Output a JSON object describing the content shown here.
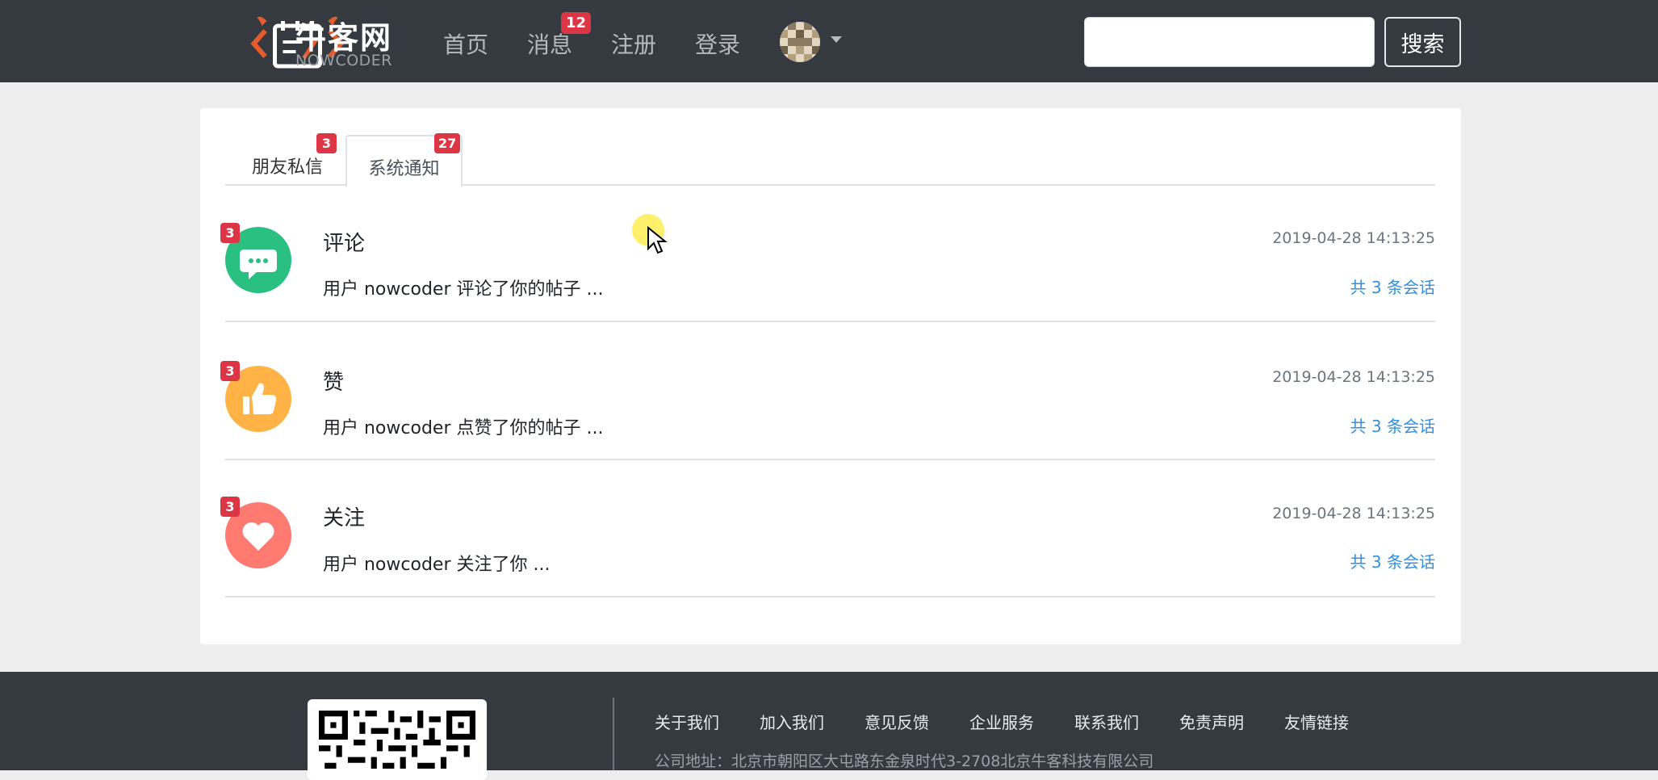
{
  "header": {
    "logo_text": "牛客网",
    "logo_sub": "NOWCODER",
    "nav": {
      "home": "首页",
      "messages": "消息",
      "messages_badge": "12",
      "register": "注册",
      "login": "登录"
    },
    "search": {
      "value": "",
      "placeholder": "",
      "button": "搜索"
    }
  },
  "tabs": [
    {
      "label": "朋友私信",
      "badge": "3"
    },
    {
      "label": "系统通知",
      "badge": "27"
    }
  ],
  "notices": [
    {
      "title": "评论",
      "text": "用户 nowcoder 评论了你的帖子 ...",
      "time": "2019-04-28 14:13:25",
      "link": "共 3 条会话",
      "badge": "3",
      "icon_color": "#2ac081"
    },
    {
      "title": "赞",
      "text": "用户 nowcoder 点赞了你的帖子 ...",
      "time": "2019-04-28 14:13:25",
      "link": "共 3 条会话",
      "badge": "3",
      "icon_color": "#ffb347"
    },
    {
      "title": "关注",
      "text": "用户 nowcoder 关注了你 ...",
      "time": "2019-04-28 14:13:25",
      "link": "共 3 条会话",
      "badge": "3",
      "icon_color": "#ff7b72"
    }
  ],
  "footer": {
    "links": [
      "关于我们",
      "加入我们",
      "意见反馈",
      "企业服务",
      "联系我们",
      "免责声明",
      "友情链接"
    ],
    "address": "公司地址：北京市朝阳区大屯路东金泉时代3-2708北京牛客科技有限公司"
  },
  "colors": {
    "header_bg": "#343a40",
    "badge": "#dc3545",
    "link": "#3490dc"
  }
}
